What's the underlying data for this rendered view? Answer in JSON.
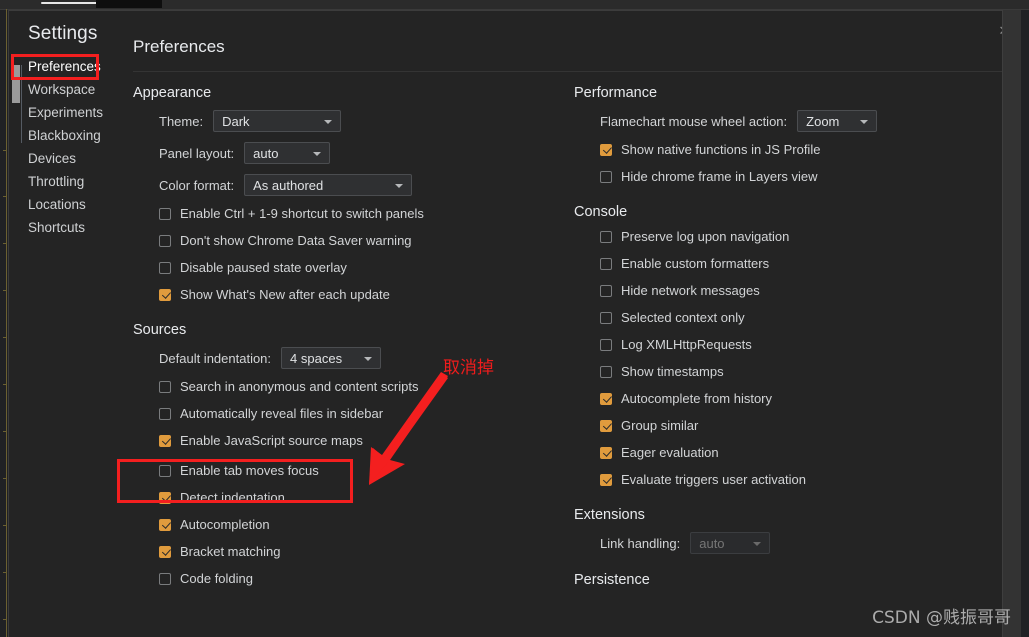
{
  "window": {
    "close_label": "✕"
  },
  "sidebar": {
    "title": "Settings",
    "items": [
      {
        "label": "Preferences"
      },
      {
        "label": "Workspace"
      },
      {
        "label": "Experiments"
      },
      {
        "label": "Blackboxing"
      },
      {
        "label": "Devices"
      },
      {
        "label": "Throttling"
      },
      {
        "label": "Locations"
      },
      {
        "label": "Shortcuts"
      }
    ]
  },
  "content": {
    "title": "Preferences"
  },
  "appearance": {
    "title": "Appearance",
    "theme_label": "Theme:",
    "theme_value": "Dark",
    "panel_layout_label": "Panel layout:",
    "panel_layout_value": "auto",
    "color_format_label": "Color format:",
    "color_format_value": "As authored",
    "checkboxes": [
      {
        "label": "Enable Ctrl + 1-9 shortcut to switch panels",
        "checked": false
      },
      {
        "label": "Don't show Chrome Data Saver warning",
        "checked": false
      },
      {
        "label": "Disable paused state overlay",
        "checked": false
      },
      {
        "label": "Show What's New after each update",
        "checked": true
      }
    ]
  },
  "sources": {
    "title": "Sources",
    "indentation_label": "Default indentation:",
    "indentation_value": "4 spaces",
    "checkboxes": [
      {
        "label": "Search in anonymous and content scripts",
        "checked": false
      },
      {
        "label": "Automatically reveal files in sidebar",
        "checked": false
      },
      {
        "label": "Enable JavaScript source maps",
        "checked": true
      },
      {
        "label": "Enable tab moves focus",
        "checked": false
      },
      {
        "label": "Detect indentation",
        "checked": true
      },
      {
        "label": "Autocompletion",
        "checked": true
      },
      {
        "label": "Bracket matching",
        "checked": true
      },
      {
        "label": "Code folding",
        "checked": false
      }
    ]
  },
  "performance": {
    "title": "Performance",
    "flamechart_label": "Flamechart mouse wheel action:",
    "flamechart_value": "Zoom",
    "checkboxes": [
      {
        "label": "Show native functions in JS Profile",
        "checked": true
      },
      {
        "label": "Hide chrome frame in Layers view",
        "checked": false
      }
    ]
  },
  "console": {
    "title": "Console",
    "checkboxes": [
      {
        "label": "Preserve log upon navigation",
        "checked": false
      },
      {
        "label": "Enable custom formatters",
        "checked": false
      },
      {
        "label": "Hide network messages",
        "checked": false
      },
      {
        "label": "Selected context only",
        "checked": false
      },
      {
        "label": "Log XMLHttpRequests",
        "checked": false
      },
      {
        "label": "Show timestamps",
        "checked": false
      },
      {
        "label": "Autocomplete from history",
        "checked": true
      },
      {
        "label": "Group similar",
        "checked": true
      },
      {
        "label": "Eager evaluation",
        "checked": true
      },
      {
        "label": "Evaluate triggers user activation",
        "checked": true
      }
    ]
  },
  "extensions": {
    "title": "Extensions",
    "link_handling_label": "Link handling:",
    "link_handling_value": "auto"
  },
  "persistence": {
    "title": "Persistence"
  },
  "annotations": {
    "note_text": "取消掉",
    "highlight_color": "#f41f1f"
  },
  "watermark": {
    "text": "CSDN @贱振哥哥"
  }
}
